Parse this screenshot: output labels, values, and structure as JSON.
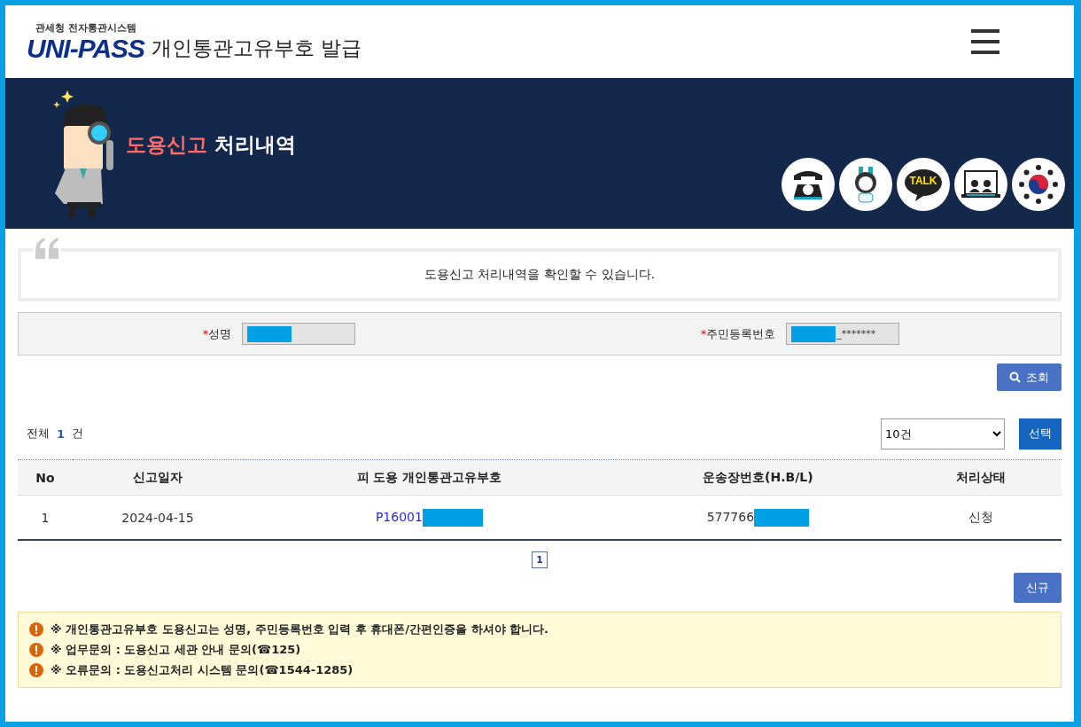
{
  "header": {
    "logo_caption": "관세청 전자통관시스템",
    "logo_text": "UNI-PASS",
    "title": "개인통관고유부호 발급"
  },
  "banner": {
    "title_highlight": "도용신고",
    "title_rest": "처리내역",
    "quick_icons": [
      {
        "kind": "telephone"
      },
      {
        "kind": "mascot"
      },
      {
        "kind": "talk",
        "label": "TALK"
      },
      {
        "kind": "video"
      },
      {
        "kind": "emblem"
      }
    ]
  },
  "intro": {
    "text": "도용신고 처리내역을 확인할 수 있습니다."
  },
  "form": {
    "fields": [
      {
        "required_mark": "*",
        "label": "성명",
        "redacted": true
      },
      {
        "required_mark": "*",
        "label": "주민등록번호",
        "value": "_*******",
        "redacted": true
      }
    ],
    "search_button": "조회"
  },
  "list_summary": {
    "prefix": "전체",
    "count": "1",
    "suffix": "건",
    "page_size": "10건",
    "select_button": "선택"
  },
  "table": {
    "columns": [
      "No",
      "신고일자",
      "피 도용 개인통관고유부호",
      "운송장번호(H.B/L)",
      "처리상태"
    ],
    "rows": [
      {
        "no": "1",
        "date": "2024-04-15",
        "code": "P16001",
        "waybill": "577766",
        "status": "신청"
      }
    ]
  },
  "pagination": [
    {
      "label": "1",
      "selected": true
    }
  ],
  "new_button": "신규",
  "notices": [
    "※ 개인통관고유부호 도용신고는 성명, 주민등록번호 입력 후 휴대폰/간편인증을 하셔야 합니다.",
    "※ 업무문의 : 도용신고 세관 안내 문의(☎125)",
    "※ 오류문의 : 도용신고처리 시스템 문의(☎1544-1285)"
  ]
}
